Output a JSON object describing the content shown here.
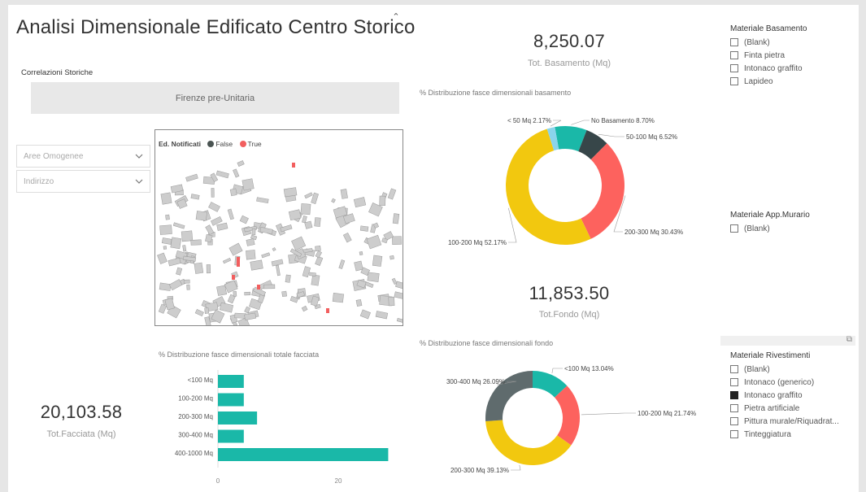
{
  "title": "Analisi Dimensionale Edificato Centro Storico",
  "scroll": {
    "up": "⌃",
    "down": "⌄"
  },
  "correlazioni": {
    "label": "Correlazioni Storiche",
    "button": "Firenze pre-Unitaria"
  },
  "filters": [
    {
      "placeholder": "Aree Omogenee"
    },
    {
      "placeholder": "Indirizzo"
    }
  ],
  "map": {
    "legend_title": "Ed. Notificati",
    "legend": [
      {
        "label": "False",
        "color": "#4a5452"
      },
      {
        "label": "True",
        "color": "#f25e5e"
      }
    ]
  },
  "kpi_basamento": {
    "value": "8,250.07",
    "label": "Tot. Basamento (Mq)"
  },
  "kpi_fondo": {
    "value": "11,853.50",
    "label": "Tot.Fondo (Mq)"
  },
  "kpi_facciata": {
    "value": "20,103.58",
    "label": "Tot.Facciata (Mq)"
  },
  "basamento_label": "% Distribuzione fasce dimensionali basamento",
  "fondo_label": "% Distribuzione fasce dimensionali fondo",
  "facciata_label": "% Distribuzione fasce dimensionali totale facciata",
  "slicer_basamento": {
    "title": "Materiale Basamento",
    "items": [
      "(Blank)",
      "Finta pietra",
      "Intonaco graffito",
      "Lapideo"
    ]
  },
  "slicer_murario": {
    "title": "Materiale App.Murario",
    "items": [
      "(Blank)"
    ]
  },
  "slicer_rivestimenti": {
    "title": "Materiale Rivestimenti",
    "items": [
      "(Blank)",
      "Intonaco (generico)",
      "Intonaco graffito",
      "Pietra artificiale",
      "Pittura murale/Riquadrat...",
      "Tinteggiatura"
    ],
    "checked": [
      false,
      false,
      true,
      false,
      false,
      false
    ],
    "focus_icon": "⧉"
  },
  "chart_data": [
    {
      "type": "pie",
      "categories": [
        "No Basamento",
        "50-100 Mq",
        "200-300 Mq",
        "100-200 Mq",
        "< 50 Mq"
      ],
      "values": [
        8.7,
        6.52,
        30.43,
        52.17,
        2.17
      ],
      "labels": [
        "No Basamento 8.70%",
        "50-100 Mq 6.52%",
        "200-300 Mq 30.43%",
        "100-200 Mq 52.17%",
        "< 50 Mq 2.17%"
      ],
      "colors": [
        "#1ab8a8",
        "#374649",
        "#fd625e",
        "#f2c80f",
        "#8ad4eb"
      ]
    },
    {
      "type": "pie",
      "categories": [
        "<100 Mq",
        "100-200 Mq",
        "200-300 Mq",
        "300-400 Mq"
      ],
      "values": [
        13.04,
        21.74,
        39.13,
        26.09
      ],
      "labels": [
        "<100 Mq 13.04%",
        "100-200 Mq 21.74%",
        "200-300 Mq 39.13%",
        "300-400 Mq 26.09%"
      ],
      "colors": [
        "#1ab8a8",
        "#fd625e",
        "#f2c80f",
        "#5f6b6d"
      ]
    },
    {
      "type": "bar",
      "orientation": "horizontal",
      "categories": [
        "<100 Mq",
        "100-200 Mq",
        "200-300 Mq",
        "300-400 Mq",
        "400-1000 Mq"
      ],
      "values": [
        4.3,
        4.3,
        6.5,
        4.3,
        28.3
      ],
      "xlim": [
        0,
        30
      ],
      "xticks": [
        "0",
        "20"
      ],
      "color": "#1ab8a8"
    }
  ]
}
